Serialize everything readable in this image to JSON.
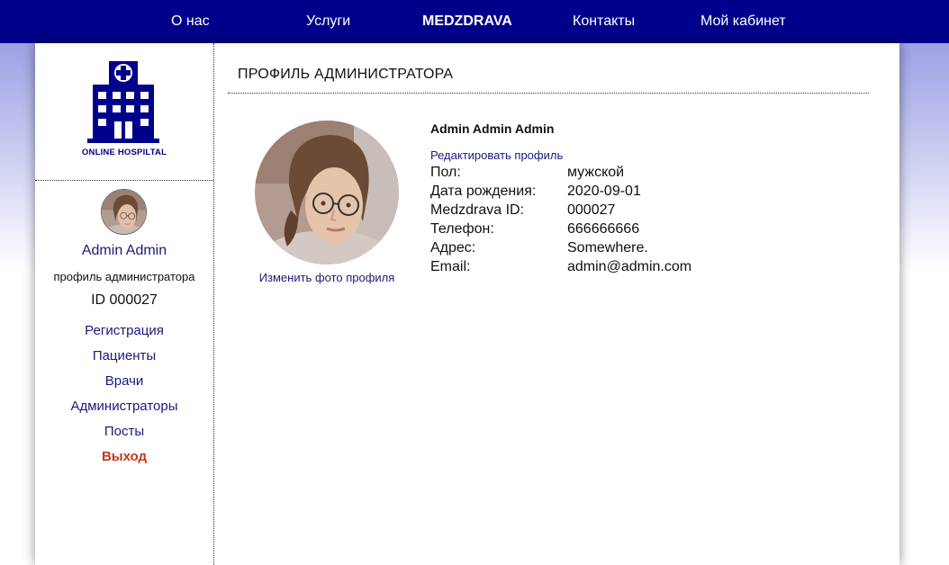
{
  "nav": {
    "items": [
      {
        "label": "О нас"
      },
      {
        "label": "Услуги"
      },
      {
        "label": "MEDZDRAVA"
      },
      {
        "label": "Контакты"
      },
      {
        "label": "Мой кабинет"
      }
    ]
  },
  "logo": {
    "text": "ONLINE HOSPILTAL"
  },
  "sidebar": {
    "user_name": "Admin Admin",
    "role": "профиль администратора",
    "id_text": "ID 000027",
    "menu": [
      {
        "label": "Регистрация"
      },
      {
        "label": "Пациенты"
      },
      {
        "label": "Врачи"
      },
      {
        "label": "Администраторы"
      },
      {
        "label": "Посты"
      },
      {
        "label": "Выход"
      }
    ]
  },
  "content": {
    "title": "ПРОФИЛЬ АДМИНИСТРАТОРА",
    "change_photo": "Изменить фото профиля",
    "full_name": "Admin Admin Admin",
    "edit_profile": "Редактировать профиль",
    "fields": [
      {
        "key": "Пол:",
        "value": "мужской"
      },
      {
        "key": "Дата рождения:",
        "value": "2020-09-01"
      },
      {
        "key": "Medzdrava ID:",
        "value": "000027"
      },
      {
        "key": "Телефон:",
        "value": "666666666"
      },
      {
        "key": "Адрес:",
        "value": "Somewhere."
      },
      {
        "key": "Email:",
        "value": "admin@admin.com"
      }
    ]
  },
  "colors": {
    "nav_bg": "#00008b",
    "link": "#1a1a7a",
    "logout": "#c0391b"
  }
}
